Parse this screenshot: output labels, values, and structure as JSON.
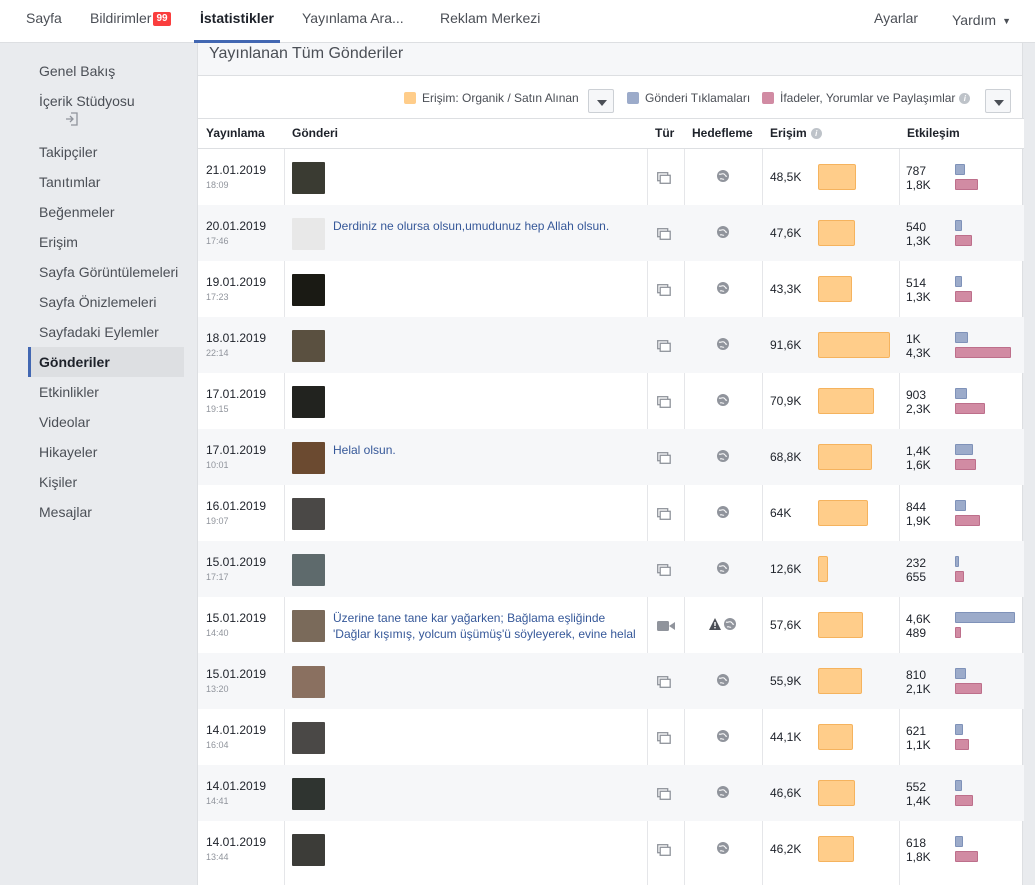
{
  "topnav": {
    "items": [
      {
        "label": "Sayfa"
      },
      {
        "label": "Bildirimler",
        "badge": "99"
      },
      {
        "label": "İstatistikler"
      },
      {
        "label": "Yayınlama Ara..."
      },
      {
        "label": "Reklam Merkezi"
      }
    ],
    "settings": "Ayarlar",
    "help": "Yardım",
    "accent": "#4267b2"
  },
  "sidebar": {
    "items": [
      {
        "label": "Genel Bakış"
      },
      {
        "label": "İçerik Stüdyosu"
      },
      {
        "label": "Takipçiler"
      },
      {
        "label": "Tanıtımlar"
      },
      {
        "label": "Beğenmeler"
      },
      {
        "label": "Erişim"
      },
      {
        "label": "Sayfa Görüntülemeleri"
      },
      {
        "label": "Sayfa Önizlemeleri"
      },
      {
        "label": "Sayfadaki Eylemler"
      },
      {
        "label": "Gönderiler"
      },
      {
        "label": "Etkinlikler"
      },
      {
        "label": "Videolar"
      },
      {
        "label": "Hikayeler"
      },
      {
        "label": "Kişiler"
      },
      {
        "label": "Mesajlar"
      }
    ],
    "active": "Gönderiler"
  },
  "panel": {
    "title": "Yayınlanan Tüm Gönderiler",
    "legend": {
      "reach": "Erişim: Organik / Satın Alınan",
      "clicks": "Gönderi Tıklamaları",
      "reactions": "İfadeler, Yorumlar ve Paylaşımlar",
      "colors": {
        "reach": "#ffcd8a",
        "clicks": "#9cabca",
        "reactions": "#d18ba3"
      }
    },
    "columns": {
      "published": "Yayınlama",
      "post": "Gönderi",
      "type": "Tür",
      "targeting": "Hedefleme",
      "reach": "Erişim",
      "engagement": "Etkileşim"
    }
  },
  "posts": [
    {
      "date": "21.01.2019",
      "time": "18:09",
      "text": "",
      "type": "photo-icon",
      "targeting": "globe-icon",
      "reach": "48,5K",
      "reach_num": 48.5,
      "clicks": "787",
      "clicks_num": 787,
      "reactions": "1,8K",
      "reactions_num": 1800,
      "thumb": "#3a3b32"
    },
    {
      "date": "20.01.2019",
      "time": "17:46",
      "text": "Derdiniz ne olursa olsun,umudunuz hep Allah olsun.",
      "type": "photo-icon",
      "targeting": "globe-icon",
      "reach": "47,6K",
      "reach_num": 47.6,
      "clicks": "540",
      "clicks_num": 540,
      "reactions": "1,3K",
      "reactions_num": 1300,
      "thumb": "#e8e8e8"
    },
    {
      "date": "19.01.2019",
      "time": "17:23",
      "text": "",
      "type": "photo-icon",
      "targeting": "globe-icon",
      "reach": "43,3K",
      "reach_num": 43.3,
      "clicks": "514",
      "clicks_num": 514,
      "reactions": "1,3K",
      "reactions_num": 1300,
      "thumb": "#1a1a14"
    },
    {
      "date": "18.01.2019",
      "time": "22:14",
      "text": "",
      "type": "photo-icon",
      "targeting": "globe-icon",
      "reach": "91,6K",
      "reach_num": 91.6,
      "clicks": "1K",
      "clicks_num": 1000,
      "reactions": "4,3K",
      "reactions_num": 4300,
      "thumb": "#5a5040"
    },
    {
      "date": "17.01.2019",
      "time": "19:15",
      "text": "",
      "type": "photo-icon",
      "targeting": "globe-icon",
      "reach": "70,9K",
      "reach_num": 70.9,
      "clicks": "903",
      "clicks_num": 903,
      "reactions": "2,3K",
      "reactions_num": 2300,
      "thumb": "#22231f"
    },
    {
      "date": "17.01.2019",
      "time": "10:01",
      "text": "Helal olsun.",
      "type": "photo-icon",
      "targeting": "globe-icon",
      "reach": "68,8K",
      "reach_num": 68.8,
      "clicks": "1,4K",
      "clicks_num": 1400,
      "reactions": "1,6K",
      "reactions_num": 1600,
      "thumb": "#6b4a30"
    },
    {
      "date": "16.01.2019",
      "time": "19:07",
      "text": "",
      "type": "photo-icon",
      "targeting": "globe-icon",
      "reach": "64K",
      "reach_num": 64,
      "clicks": "844",
      "clicks_num": 844,
      "reactions": "1,9K",
      "reactions_num": 1900,
      "thumb": "#4a4846"
    },
    {
      "date": "15.01.2019",
      "time": "17:17",
      "text": "",
      "type": "photo-icon",
      "targeting": "globe-icon",
      "reach": "12,6K",
      "reach_num": 12.6,
      "clicks": "232",
      "clicks_num": 232,
      "reactions": "655",
      "reactions_num": 655,
      "thumb": "#5e6a6c"
    },
    {
      "date": "15.01.2019",
      "time": "14:40",
      "text": "Üzerine tane tane kar yağarken; Bağlama eşliğinde 'Dağlar kışımış, yolcum üşümüş'ü söyleyerek, evine helal",
      "type": "video-icon",
      "targeting": "warning-globe-icon",
      "reach": "57,6K",
      "reach_num": 57.6,
      "clicks": "4,6K",
      "clicks_num": 4600,
      "reactions": "489",
      "reactions_num": 489,
      "thumb": "#7a6a5a"
    },
    {
      "date": "15.01.2019",
      "time": "13:20",
      "text": "",
      "type": "photo-icon",
      "targeting": "globe-icon",
      "reach": "55,9K",
      "reach_num": 55.9,
      "clicks": "810",
      "clicks_num": 810,
      "reactions": "2,1K",
      "reactions_num": 2100,
      "thumb": "#8a7060"
    },
    {
      "date": "14.01.2019",
      "time": "16:04",
      "text": "",
      "type": "photo-icon",
      "targeting": "globe-icon",
      "reach": "44,1K",
      "reach_num": 44.1,
      "clicks": "621",
      "clicks_num": 621,
      "reactions": "1,1K",
      "reactions_num": 1100,
      "thumb": "#4a4846"
    },
    {
      "date": "14.01.2019",
      "time": "14:41",
      "text": "",
      "type": "photo-icon",
      "targeting": "globe-icon",
      "reach": "46,6K",
      "reach_num": 46.6,
      "clicks": "552",
      "clicks_num": 552,
      "reactions": "1,4K",
      "reactions_num": 1400,
      "thumb": "#2f3430"
    },
    {
      "date": "14.01.2019",
      "time": "13:44",
      "text": "",
      "type": "photo-icon",
      "targeting": "globe-icon",
      "reach": "46,2K",
      "reach_num": 46.2,
      "clicks": "618",
      "clicks_num": 618,
      "reactions": "1,8K",
      "reactions_num": 1800,
      "thumb": "#3c3c38"
    }
  ]
}
